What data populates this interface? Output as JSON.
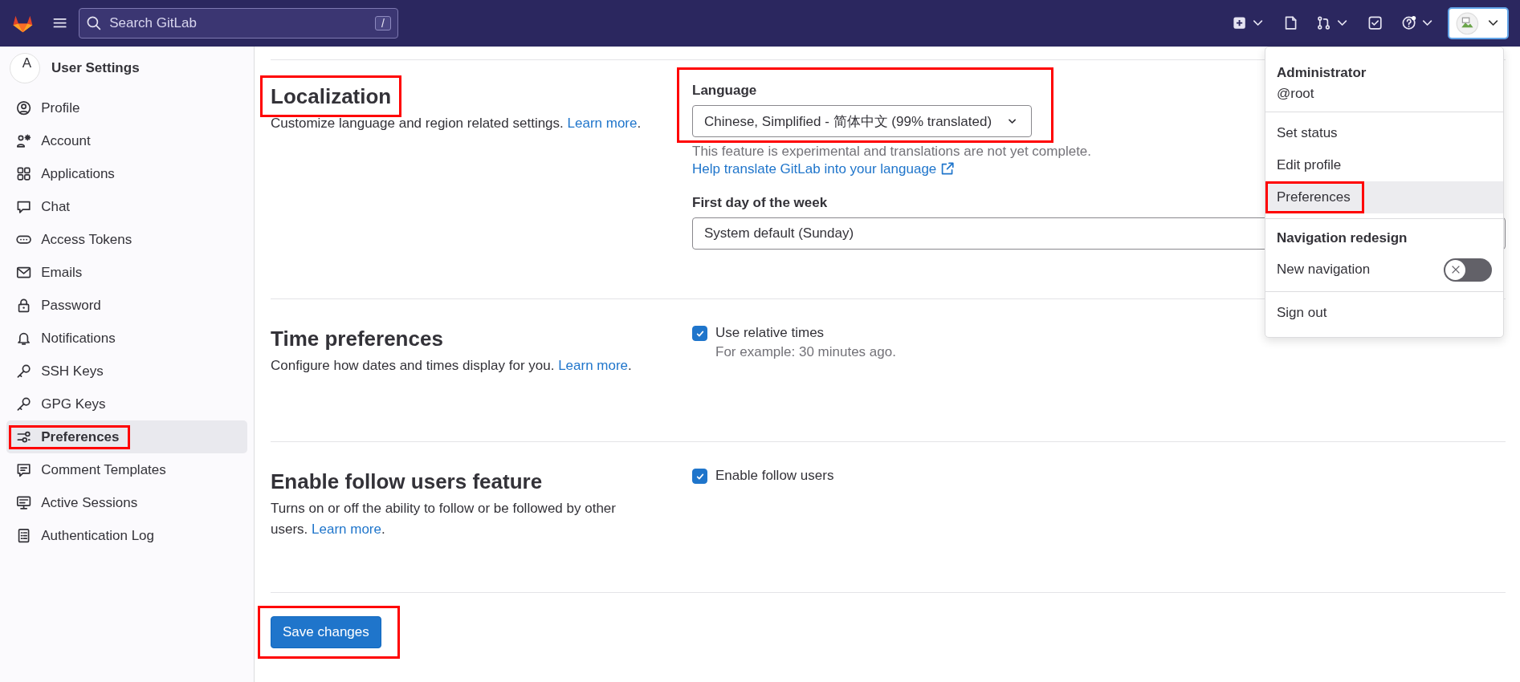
{
  "top_bar": {
    "search": {
      "placeholder": "Search GitLab",
      "shortcut": "/"
    }
  },
  "sidebar": {
    "avatar_text": "A",
    "title": "User Settings",
    "items": [
      {
        "label": "Profile",
        "selected": false,
        "highlighted": false
      },
      {
        "label": "Account",
        "selected": false,
        "highlighted": false
      },
      {
        "label": "Applications",
        "selected": false,
        "highlighted": false
      },
      {
        "label": "Chat",
        "selected": false,
        "highlighted": false
      },
      {
        "label": "Access Tokens",
        "selected": false,
        "highlighted": false
      },
      {
        "label": "Emails",
        "selected": false,
        "highlighted": false
      },
      {
        "label": "Password",
        "selected": false,
        "highlighted": false
      },
      {
        "label": "Notifications",
        "selected": false,
        "highlighted": false
      },
      {
        "label": "SSH Keys",
        "selected": false,
        "highlighted": false
      },
      {
        "label": "GPG Keys",
        "selected": false,
        "highlighted": false
      },
      {
        "label": "Preferences",
        "selected": true,
        "highlighted": true
      },
      {
        "label": "Comment Templates",
        "selected": false,
        "highlighted": false
      },
      {
        "label": "Active Sessions",
        "selected": false,
        "highlighted": false
      },
      {
        "label": "Authentication Log",
        "selected": false,
        "highlighted": false
      }
    ]
  },
  "sections": [
    {
      "title": "Localization",
      "highlighted": true,
      "description": "Customize language and region related settings. ",
      "link": "Learn more",
      "after_link": ".",
      "controls": [
        {
          "kind": "select",
          "label": "Language",
          "value": "Chinese, Simplified - 简体中文 (99% translated)",
          "caret": true,
          "highlighted": true,
          "help": "This feature is experimental and translations are not yet complete.",
          "help_link": "Help translate GitLab into your language"
        },
        {
          "kind": "select",
          "label": "First day of the week",
          "value": "System default (Sunday)",
          "caret": false,
          "highlighted": false
        }
      ]
    },
    {
      "title": "Time preferences",
      "highlighted": false,
      "description": "Configure how dates and times display for you. ",
      "link": "Learn more",
      "after_link": ".",
      "controls": [
        {
          "kind": "checkbox",
          "label": "Use relative times",
          "checked": true,
          "hint": "For example: 30 minutes ago."
        }
      ]
    },
    {
      "title": "Enable follow users feature",
      "highlighted": false,
      "description": "Turns on or off the ability to follow or be followed by other users. ",
      "link": "Learn more",
      "after_link": ".",
      "controls": [
        {
          "kind": "checkbox",
          "label": "Enable follow users",
          "checked": true
        }
      ]
    }
  ],
  "save_button": {
    "label": "Save changes",
    "highlighted": true
  },
  "user_menu": {
    "name": "Administrator",
    "username": "@root",
    "items": [
      {
        "label": "Set status",
        "selected": false,
        "highlighted": false
      },
      {
        "label": "Edit profile",
        "selected": false,
        "highlighted": false
      },
      {
        "label": "Preferences",
        "selected": true,
        "highlighted": true
      }
    ],
    "group_title": "Navigation redesign",
    "toggle": {
      "label": "New navigation",
      "on": false
    },
    "sign_out": "Sign out"
  }
}
